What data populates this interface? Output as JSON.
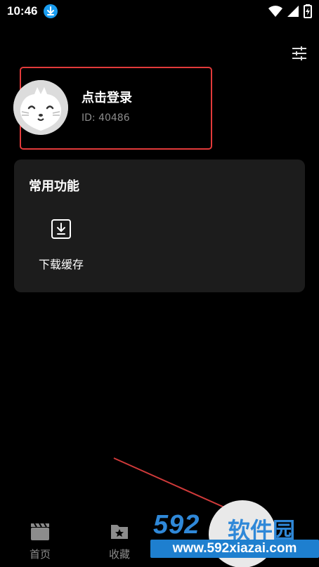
{
  "status_bar": {
    "time": "10:46"
  },
  "profile": {
    "title": "点击登录",
    "id_text": "ID: 40486"
  },
  "common_functions": {
    "title": "常用功能",
    "items": [
      {
        "label": "下载缓存",
        "icon": "download-icon"
      }
    ]
  },
  "bottom_nav": {
    "items": [
      {
        "label": "首页",
        "icon": "clapperboard-icon"
      },
      {
        "label": "收藏",
        "icon": "folder-star-icon"
      }
    ]
  },
  "watermark": {
    "brand": "592",
    "brand_cn": "软件园",
    "url": "www.592xiazai.com"
  },
  "colors": {
    "background": "#000000",
    "card": "#1c1c1c",
    "highlight_border": "#e23a3a",
    "muted_text": "#8c8c8c",
    "watermark_blue": "#1e7fcf"
  }
}
